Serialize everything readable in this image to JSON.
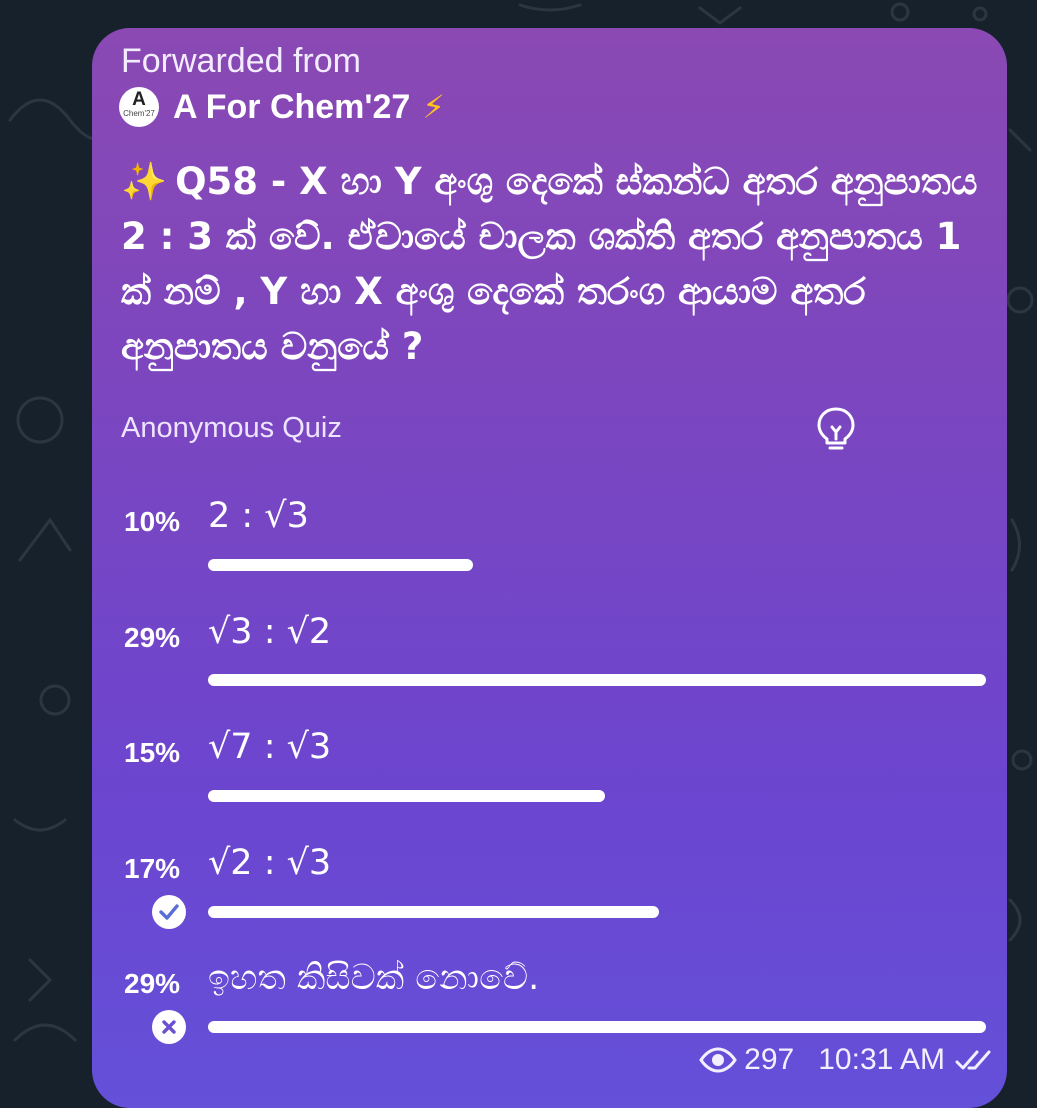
{
  "message": {
    "forwarded_label": "Forwarded from",
    "channel": {
      "avatar_letter": "A",
      "avatar_caption": "Chem'27",
      "name": "A For Chem'27",
      "emoji": "⚡"
    },
    "question_emoji": "✨",
    "question": "Q58 - X හා Y අංශු දෙකේ ස්කන්ධ අතර අනුපාතය 2 : 3 ක් වේ. ඒවායේ චාලක ශක්ති අතර අනුපාතය 1 ක් නම් , Y හා X අංශු දෙකේ තරංග ආයාම අතර අනුපාතය වනුයේ ?",
    "quiz_type": "Anonymous Quiz",
    "options": [
      {
        "percent_label": "10%",
        "text": "2 : √3",
        "percent": 10,
        "bar_fraction": 0.34
      },
      {
        "percent_label": "29%",
        "text": "√3 : √2",
        "percent": 29,
        "bar_fraction": 1.0
      },
      {
        "percent_label": "15%",
        "text": "√7 : √3",
        "percent": 15,
        "bar_fraction": 0.51
      },
      {
        "percent_label": "17%",
        "text": "√2 : √3",
        "percent": 17,
        "bar_fraction": 0.58,
        "mark": "correct"
      },
      {
        "percent_label": "29%",
        "text": "ඉහත කිසිවක් නොවේ.",
        "percent": 29,
        "bar_fraction": 1.0,
        "mark": "chosen-wrong"
      }
    ],
    "views": "297",
    "time": "10:31 AM",
    "status": "read"
  },
  "colors": {
    "background": "#17212b",
    "bubble_top": "#8a49b3",
    "bubble_bottom": "#6450d9",
    "check_icon": "#5a6fd6",
    "cross_icon": "#6a4fd1",
    "bolt": "#ffc21a"
  }
}
